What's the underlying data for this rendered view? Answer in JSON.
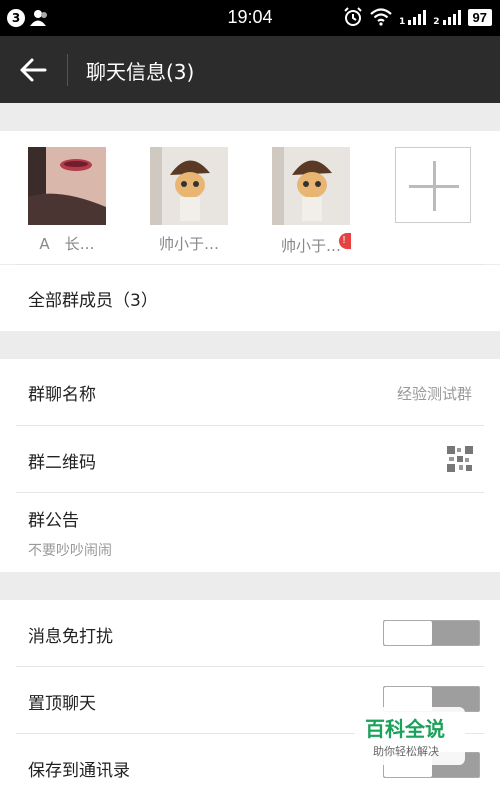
{
  "status_bar": {
    "notification_count": "3",
    "time": "19:04",
    "signal1_label": "1",
    "signal2_label": "2",
    "battery": "97"
  },
  "header": {
    "title": "聊天信息(3)"
  },
  "members": [
    {
      "name": "A　长…"
    },
    {
      "name": "帅小于…"
    },
    {
      "name": "帅小于…"
    }
  ],
  "all_members": "全部群成员（3）",
  "settings": {
    "group_name_label": "群聊名称",
    "group_name_value": "经验测试群",
    "qr_label": "群二维码",
    "notice_label": "群公告",
    "notice_value": "不要吵吵闹闹",
    "mute_label": "消息免打扰",
    "pin_label": "置顶聊天",
    "save_label": "保存到通讯录"
  },
  "watermark": {
    "title": "百科全说",
    "subtitle": "助你轻松解决"
  }
}
